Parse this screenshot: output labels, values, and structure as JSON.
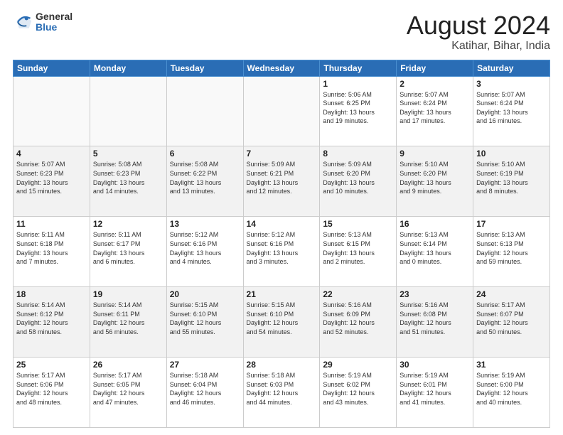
{
  "logo": {
    "general": "General",
    "blue": "Blue"
  },
  "title": {
    "month_year": "August 2024",
    "location": "Katihar, Bihar, India"
  },
  "days_of_week": [
    "Sunday",
    "Monday",
    "Tuesday",
    "Wednesday",
    "Thursday",
    "Friday",
    "Saturday"
  ],
  "weeks": [
    [
      {
        "day": "",
        "info": ""
      },
      {
        "day": "",
        "info": ""
      },
      {
        "day": "",
        "info": ""
      },
      {
        "day": "",
        "info": ""
      },
      {
        "day": "1",
        "info": "Sunrise: 5:06 AM\nSunset: 6:25 PM\nDaylight: 13 hours\nand 19 minutes."
      },
      {
        "day": "2",
        "info": "Sunrise: 5:07 AM\nSunset: 6:24 PM\nDaylight: 13 hours\nand 17 minutes."
      },
      {
        "day": "3",
        "info": "Sunrise: 5:07 AM\nSunset: 6:24 PM\nDaylight: 13 hours\nand 16 minutes."
      }
    ],
    [
      {
        "day": "4",
        "info": "Sunrise: 5:07 AM\nSunset: 6:23 PM\nDaylight: 13 hours\nand 15 minutes."
      },
      {
        "day": "5",
        "info": "Sunrise: 5:08 AM\nSunset: 6:23 PM\nDaylight: 13 hours\nand 14 minutes."
      },
      {
        "day": "6",
        "info": "Sunrise: 5:08 AM\nSunset: 6:22 PM\nDaylight: 13 hours\nand 13 minutes."
      },
      {
        "day": "7",
        "info": "Sunrise: 5:09 AM\nSunset: 6:21 PM\nDaylight: 13 hours\nand 12 minutes."
      },
      {
        "day": "8",
        "info": "Sunrise: 5:09 AM\nSunset: 6:20 PM\nDaylight: 13 hours\nand 10 minutes."
      },
      {
        "day": "9",
        "info": "Sunrise: 5:10 AM\nSunset: 6:20 PM\nDaylight: 13 hours\nand 9 minutes."
      },
      {
        "day": "10",
        "info": "Sunrise: 5:10 AM\nSunset: 6:19 PM\nDaylight: 13 hours\nand 8 minutes."
      }
    ],
    [
      {
        "day": "11",
        "info": "Sunrise: 5:11 AM\nSunset: 6:18 PM\nDaylight: 13 hours\nand 7 minutes."
      },
      {
        "day": "12",
        "info": "Sunrise: 5:11 AM\nSunset: 6:17 PM\nDaylight: 13 hours\nand 6 minutes."
      },
      {
        "day": "13",
        "info": "Sunrise: 5:12 AM\nSunset: 6:16 PM\nDaylight: 13 hours\nand 4 minutes."
      },
      {
        "day": "14",
        "info": "Sunrise: 5:12 AM\nSunset: 6:16 PM\nDaylight: 13 hours\nand 3 minutes."
      },
      {
        "day": "15",
        "info": "Sunrise: 5:13 AM\nSunset: 6:15 PM\nDaylight: 13 hours\nand 2 minutes."
      },
      {
        "day": "16",
        "info": "Sunrise: 5:13 AM\nSunset: 6:14 PM\nDaylight: 13 hours\nand 0 minutes."
      },
      {
        "day": "17",
        "info": "Sunrise: 5:13 AM\nSunset: 6:13 PM\nDaylight: 12 hours\nand 59 minutes."
      }
    ],
    [
      {
        "day": "18",
        "info": "Sunrise: 5:14 AM\nSunset: 6:12 PM\nDaylight: 12 hours\nand 58 minutes."
      },
      {
        "day": "19",
        "info": "Sunrise: 5:14 AM\nSunset: 6:11 PM\nDaylight: 12 hours\nand 56 minutes."
      },
      {
        "day": "20",
        "info": "Sunrise: 5:15 AM\nSunset: 6:10 PM\nDaylight: 12 hours\nand 55 minutes."
      },
      {
        "day": "21",
        "info": "Sunrise: 5:15 AM\nSunset: 6:10 PM\nDaylight: 12 hours\nand 54 minutes."
      },
      {
        "day": "22",
        "info": "Sunrise: 5:16 AM\nSunset: 6:09 PM\nDaylight: 12 hours\nand 52 minutes."
      },
      {
        "day": "23",
        "info": "Sunrise: 5:16 AM\nSunset: 6:08 PM\nDaylight: 12 hours\nand 51 minutes."
      },
      {
        "day": "24",
        "info": "Sunrise: 5:17 AM\nSunset: 6:07 PM\nDaylight: 12 hours\nand 50 minutes."
      }
    ],
    [
      {
        "day": "25",
        "info": "Sunrise: 5:17 AM\nSunset: 6:06 PM\nDaylight: 12 hours\nand 48 minutes."
      },
      {
        "day": "26",
        "info": "Sunrise: 5:17 AM\nSunset: 6:05 PM\nDaylight: 12 hours\nand 47 minutes."
      },
      {
        "day": "27",
        "info": "Sunrise: 5:18 AM\nSunset: 6:04 PM\nDaylight: 12 hours\nand 46 minutes."
      },
      {
        "day": "28",
        "info": "Sunrise: 5:18 AM\nSunset: 6:03 PM\nDaylight: 12 hours\nand 44 minutes."
      },
      {
        "day": "29",
        "info": "Sunrise: 5:19 AM\nSunset: 6:02 PM\nDaylight: 12 hours\nand 43 minutes."
      },
      {
        "day": "30",
        "info": "Sunrise: 5:19 AM\nSunset: 6:01 PM\nDaylight: 12 hours\nand 41 minutes."
      },
      {
        "day": "31",
        "info": "Sunrise: 5:19 AM\nSunset: 6:00 PM\nDaylight: 12 hours\nand 40 minutes."
      }
    ]
  ]
}
